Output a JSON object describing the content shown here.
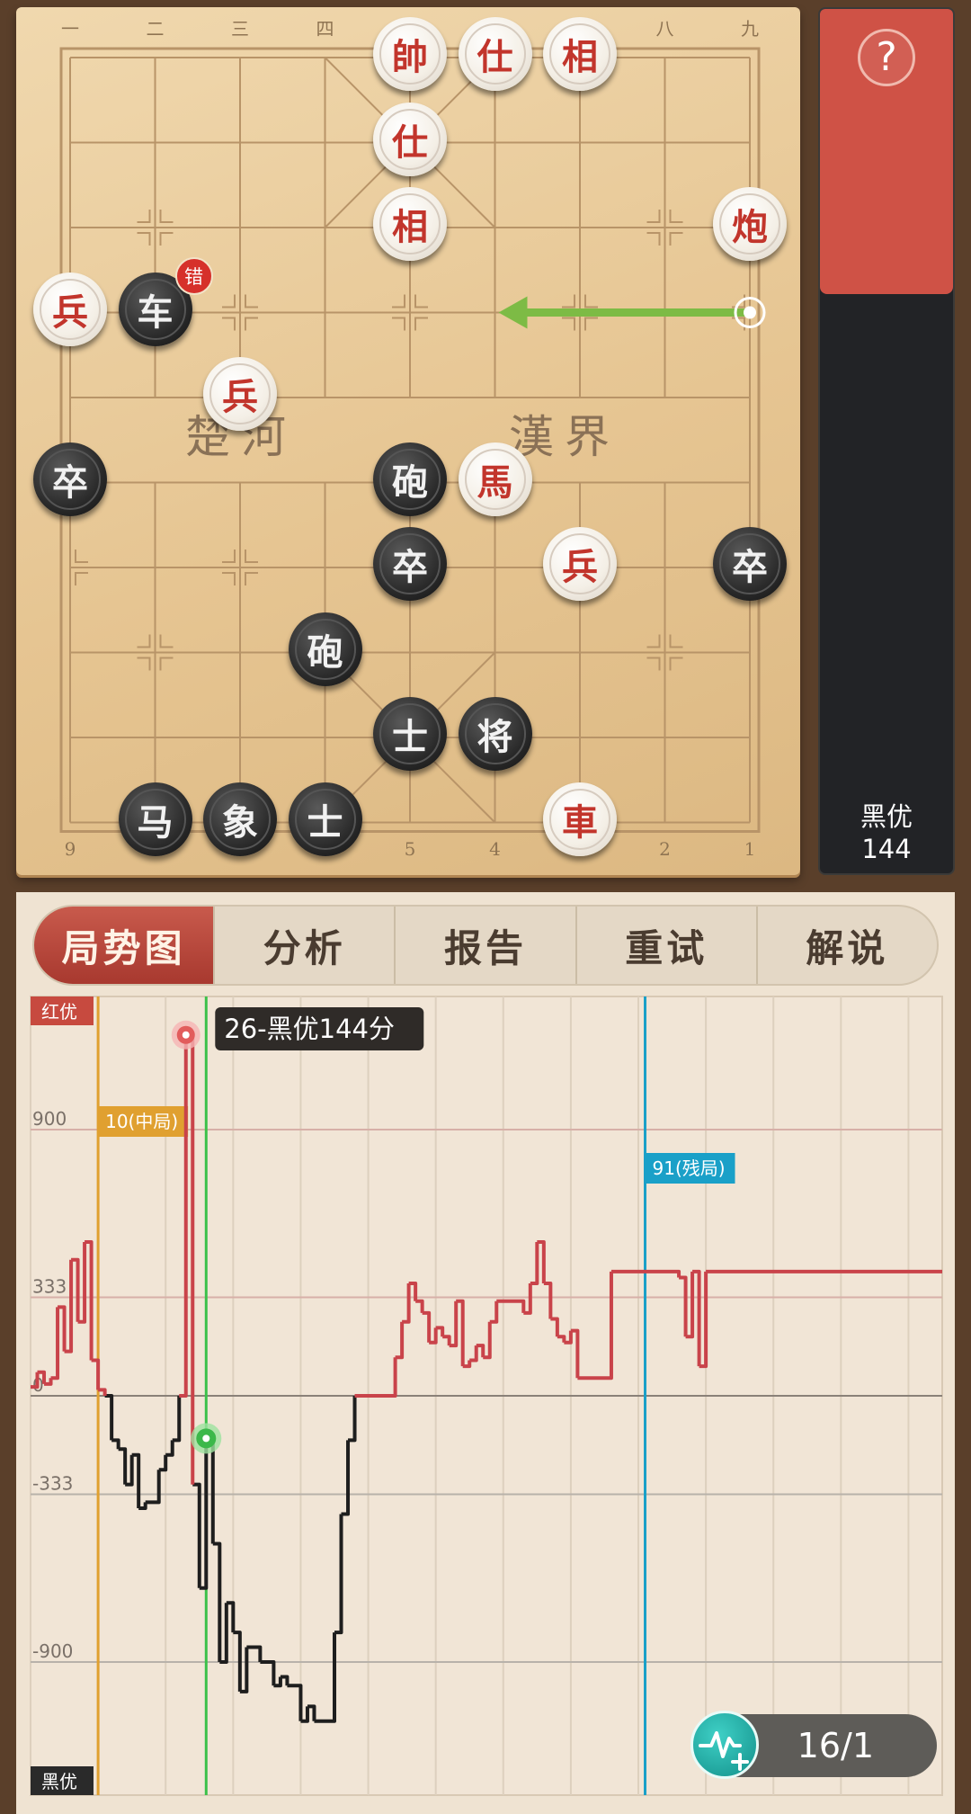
{
  "board": {
    "file_labels_top": [
      "一",
      "二",
      "三",
      "四",
      "五",
      "六",
      "七",
      "八",
      "九"
    ],
    "file_labels_bottom": [
      "9",
      "8",
      "7",
      "6",
      "5",
      "4",
      "3",
      "2",
      "1"
    ],
    "river_left": "楚河",
    "river_right": "漢界",
    "error_badge": "错",
    "pieces": [
      {
        "id": "red-shuai",
        "char": "帥",
        "side": "red",
        "col": 4,
        "row": 0
      },
      {
        "id": "red-shi-a",
        "char": "仕",
        "side": "red",
        "col": 5,
        "row": 0
      },
      {
        "id": "red-xiang-a",
        "char": "相",
        "side": "red",
        "col": 6,
        "row": 0
      },
      {
        "id": "red-shi-b",
        "char": "仕",
        "side": "red",
        "col": 4,
        "row": 1
      },
      {
        "id": "red-xiang-b",
        "char": "相",
        "side": "red",
        "col": 4,
        "row": 2
      },
      {
        "id": "red-pao",
        "char": "炮",
        "side": "red",
        "col": 8,
        "row": 2
      },
      {
        "id": "red-bing-a",
        "char": "兵",
        "side": "red",
        "col": 0,
        "row": 3
      },
      {
        "id": "black-che",
        "char": "车",
        "side": "black",
        "col": 1,
        "row": 3
      },
      {
        "id": "red-bing-b",
        "char": "兵",
        "side": "red",
        "col": 2,
        "row": 4
      },
      {
        "id": "black-zu-a",
        "char": "卒",
        "side": "black",
        "col": 0,
        "row": 5
      },
      {
        "id": "black-pao-a",
        "char": "砲",
        "side": "black",
        "col": 4,
        "row": 5
      },
      {
        "id": "red-ma",
        "char": "馬",
        "side": "red",
        "col": 5,
        "row": 5
      },
      {
        "id": "black-zu-b",
        "char": "卒",
        "side": "black",
        "col": 4,
        "row": 6
      },
      {
        "id": "red-bing-c",
        "char": "兵",
        "side": "red",
        "col": 6,
        "row": 6
      },
      {
        "id": "black-zu-c",
        "char": "卒",
        "side": "black",
        "col": 8,
        "row": 6
      },
      {
        "id": "black-pao-b",
        "char": "砲",
        "side": "black",
        "col": 3,
        "row": 7
      },
      {
        "id": "black-shi-a",
        "char": "士",
        "side": "black",
        "col": 4,
        "row": 8
      },
      {
        "id": "black-jiang",
        "char": "将",
        "side": "black",
        "col": 5,
        "row": 8
      },
      {
        "id": "black-ma",
        "char": "马",
        "side": "black",
        "col": 1,
        "row": 9
      },
      {
        "id": "black-xiang",
        "char": "象",
        "side": "black",
        "col": 2,
        "row": 9
      },
      {
        "id": "black-shi-b",
        "char": "士",
        "side": "black",
        "col": 3,
        "row": 9
      },
      {
        "id": "red-che",
        "char": "車",
        "side": "red",
        "col": 6,
        "row": 9
      }
    ],
    "hint_arrow": {
      "from_col": 8,
      "from_row": 3,
      "to_col": 5,
      "to_row": 3
    },
    "error_piece": "black-che"
  },
  "eval_bar": {
    "label_line1": "黑优",
    "label_line2": "144",
    "red_fraction": 0.33,
    "red_color": "#cf5246",
    "black_color": "#222326"
  },
  "tabs": [
    {
      "label": "局势图",
      "active": true
    },
    {
      "label": "分析",
      "active": false
    },
    {
      "label": "报告",
      "active": false
    },
    {
      "label": "重试",
      "active": false
    },
    {
      "label": "解说",
      "active": false
    }
  ],
  "chart_data": {
    "type": "line",
    "red_label": "红优",
    "black_label": "黑优",
    "y_ticks": [
      900,
      333,
      0,
      -333,
      -900
    ],
    "y_tick_labels": [
      "900",
      "333",
      "0",
      "-333",
      "-900"
    ],
    "ylim": [
      -1350,
      1350
    ],
    "xlim": [
      0,
      135
    ],
    "x_gridlines": [
      0,
      10,
      20,
      30,
      40,
      50,
      60,
      70,
      80,
      90,
      100,
      110,
      120,
      130
    ],
    "markers": [
      {
        "move": 10,
        "label": "10(中局)",
        "color": "#e0a030"
      },
      {
        "move": 91,
        "label": "91(残局)",
        "color": "#1aa0c8"
      }
    ],
    "current": {
      "move": 26,
      "value": -144,
      "label": "26-黑优144分",
      "color": "#3cc14a"
    },
    "highlight_point": {
      "move": 23,
      "value": 1220
    },
    "series": {
      "x": [
        0,
        1,
        2,
        3,
        4,
        5,
        6,
        7,
        8,
        9,
        10,
        11,
        12,
        13,
        14,
        15,
        16,
        17,
        18,
        19,
        20,
        21,
        22,
        23,
        24,
        25,
        26,
        27,
        28,
        29,
        30,
        31,
        32,
        33,
        34,
        35,
        36,
        37,
        38,
        39,
        40,
        41,
        42,
        43,
        44,
        45,
        46,
        47,
        48,
        49,
        50,
        51,
        52,
        53,
        54,
        55,
        56,
        57,
        58,
        59,
        60,
        61,
        62,
        63,
        64,
        65,
        66,
        67,
        68,
        69,
        70,
        71,
        72,
        73,
        74,
        75,
        76,
        77,
        78,
        79,
        80,
        81,
        82,
        83,
        84,
        85,
        86,
        87,
        88,
        89,
        90,
        91,
        92,
        93,
        94,
        95,
        96,
        97,
        98,
        99,
        100,
        101,
        102,
        103,
        104,
        105,
        106,
        107,
        108,
        109,
        110,
        111,
        112,
        113,
        114,
        115,
        116,
        117,
        118,
        119,
        120,
        121,
        122,
        123,
        124,
        125,
        126,
        127,
        128,
        129,
        130,
        131,
        132,
        133,
        134,
        135
      ],
      "y": [
        30,
        80,
        40,
        60,
        300,
        150,
        460,
        250,
        520,
        120,
        20,
        0,
        -150,
        -180,
        -300,
        -200,
        -380,
        -360,
        -360,
        -250,
        -200,
        -150,
        0,
        1220,
        -300,
        -650,
        -144,
        -500,
        -900,
        -700,
        -800,
        -1000,
        -850,
        -850,
        -900,
        -900,
        -980,
        -950,
        -980,
        -980,
        -1100,
        -1050,
        -1100,
        -1100,
        -1100,
        -800,
        -400,
        -150,
        0,
        0,
        0,
        0,
        0,
        0,
        130,
        250,
        380,
        320,
        280,
        180,
        230,
        200,
        170,
        320,
        100,
        120,
        170,
        130,
        250,
        320,
        320,
        320,
        320,
        280,
        380,
        520,
        380,
        260,
        200,
        180,
        220,
        60,
        60,
        60,
        60,
        60,
        420,
        420,
        420,
        420,
        420,
        420,
        420,
        420,
        420,
        420,
        400,
        200,
        420,
        100,
        420,
        420,
        420,
        420,
        420,
        420,
        420,
        420,
        420,
        420,
        420,
        420,
        420,
        420,
        420,
        420,
        420,
        420,
        420,
        420,
        420,
        420,
        420,
        420,
        420,
        420,
        420,
        420,
        420,
        420,
        420,
        420,
        420,
        420,
        420,
        420,
        420
      ]
    }
  },
  "counter": {
    "text": "16/1"
  }
}
